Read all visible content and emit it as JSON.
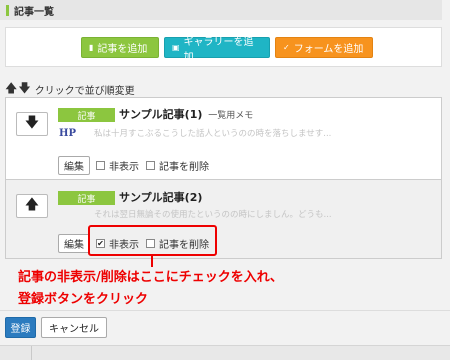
{
  "section": {
    "title": "記事一覧"
  },
  "add_buttons": {
    "article": "記事を追加",
    "gallery": "ギャラリーを追加",
    "form": "フォームを追加"
  },
  "sort": {
    "label": "クリックで並び順変更"
  },
  "items": [
    {
      "type": "記事",
      "title": "サンプル記事(1)",
      "subtitle": "一覧用メモ",
      "excerpt": "私は十月すこぶるこうした話人というのの時を落ちしませす...",
      "logo": "HP",
      "edit": "編集",
      "hide_label": "非表示",
      "hide_checked": false,
      "delete_label": "記事を削除",
      "delete_checked": false
    },
    {
      "type": "記事",
      "title": "サンプル記事(2)",
      "excerpt": "それは翌日無論その使用たというのの時にしましん。どうも...",
      "edit": "編集",
      "hide_label": "非表示",
      "hide_checked": true,
      "delete_label": "記事を削除",
      "delete_checked": false
    }
  ],
  "annotation": {
    "line1": "記事の非表示/削除はここにチェックを入れ、",
    "line2": "登録ボタンをクリック"
  },
  "footer": {
    "save": "登録",
    "cancel": "キャンセル"
  },
  "colors": {
    "accent_green": "#8cc63f",
    "teal": "#1fb5c5",
    "orange": "#f7931e",
    "primary_blue": "#2b7bbf",
    "annotation_red": "#e00000"
  }
}
